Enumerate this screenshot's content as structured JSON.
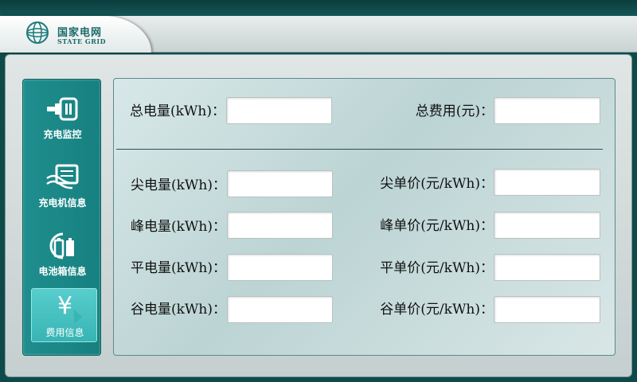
{
  "header": {
    "logo_cn": "国家电网",
    "logo_en": "STATE GRID"
  },
  "sidebar": {
    "items": [
      {
        "label": "充电监控",
        "icon": "charging-plug-icon",
        "active": false
      },
      {
        "label": "充电机信息",
        "icon": "charger-info-icon",
        "active": false
      },
      {
        "label": "电池箱信息",
        "icon": "battery-box-icon",
        "active": false
      },
      {
        "label": "费用信息",
        "icon": "yen-icon",
        "active": true,
        "symbol": "¥"
      }
    ]
  },
  "summary": {
    "total_energy_label": "总电量(kWh)：",
    "total_energy_value": "",
    "total_cost_label": "总费用(元)：",
    "total_cost_value": ""
  },
  "breakdown": [
    {
      "energy_label": "尖电量(kWh)：",
      "energy_value": "",
      "price_label": "尖单价(元/kWh)：",
      "price_value": ""
    },
    {
      "energy_label": "峰电量(kWh)：",
      "energy_value": "",
      "price_label": "峰单价(元/kWh)：",
      "price_value": ""
    },
    {
      "energy_label": "平电量(kWh)：",
      "energy_value": "",
      "price_label": "平单价(元/kWh)：",
      "price_value": ""
    },
    {
      "energy_label": "谷电量(kWh)：",
      "energy_value": "",
      "price_label": "谷单价(元/kWh)：",
      "price_value": ""
    }
  ],
  "colors": {
    "brand_teal": "#1f8e8e",
    "active_tab": "#38b4b4",
    "header_bg": "#0f4a4a"
  }
}
